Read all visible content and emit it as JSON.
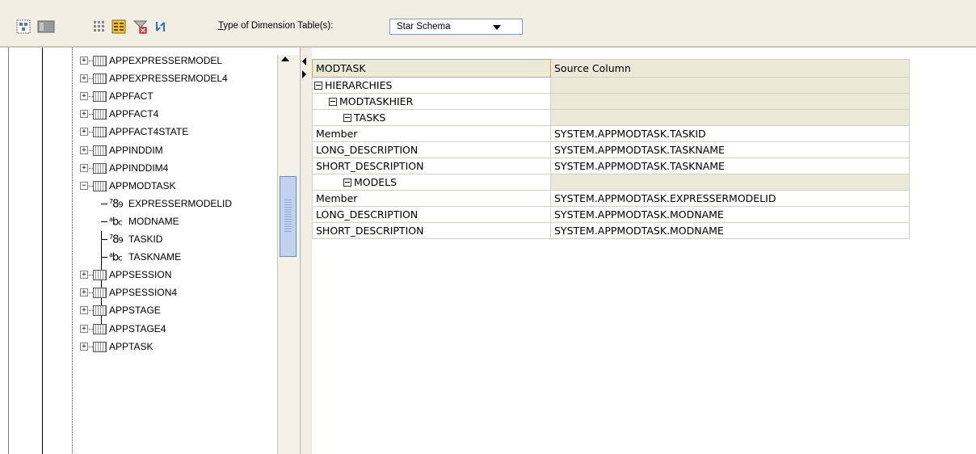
{
  "toolbar": {
    "icons": [
      "layout-icon",
      "panel-icon",
      "grid-icon",
      "table-columns-icon",
      "filter-delete-icon",
      "refresh-icon"
    ],
    "dim_label_accel": "T",
    "dim_label_rest": "ype of Dimension Table(s):",
    "dim_select_value": "Star Schema"
  },
  "tree": {
    "items": [
      {
        "label": "APPEXPRESSERMODEL",
        "kind": "table",
        "expander": "+"
      },
      {
        "label": "APPEXPRESSERMODEL4",
        "kind": "table",
        "expander": "+"
      },
      {
        "label": "APPFACT",
        "kind": "table",
        "expander": "+"
      },
      {
        "label": "APPFACT4",
        "kind": "table",
        "expander": "+"
      },
      {
        "label": "APPFACT4STATE",
        "kind": "table",
        "expander": "+"
      },
      {
        "label": "APPINDDIM",
        "kind": "table",
        "expander": "+"
      },
      {
        "label": "APPINDDIM4",
        "kind": "table",
        "expander": "+"
      },
      {
        "label": "APPMODTASK",
        "kind": "table",
        "expander": "−"
      },
      {
        "label": "EXPRESSERMODELID",
        "kind": "number"
      },
      {
        "label": "MODNAME",
        "kind": "text"
      },
      {
        "label": "TASKID",
        "kind": "number"
      },
      {
        "label": "TASKNAME",
        "kind": "text"
      },
      {
        "label": "APPSESSION",
        "kind": "table",
        "expander": "+"
      },
      {
        "label": "APPSESSION4",
        "kind": "table",
        "expander": "+"
      },
      {
        "label": "APPSTAGE",
        "kind": "table",
        "expander": "+"
      },
      {
        "label": "APPSTAGE4",
        "kind": "table",
        "expander": "+"
      },
      {
        "label": "APPTASK",
        "kind": "table",
        "expander": "+"
      }
    ]
  },
  "grid": {
    "headers": {
      "col1": "MODTASK",
      "col2": "Source Column"
    },
    "rows": [
      {
        "level": 0,
        "label": "HIERARCHIES",
        "collapsible": true,
        "source": ""
      },
      {
        "level": 1,
        "label": "MODTASKHIER",
        "collapsible": true,
        "source": ""
      },
      {
        "level": 2,
        "label": "TASKS",
        "collapsible": true,
        "source": ""
      },
      {
        "level": 3,
        "label": "Member",
        "collapsible": false,
        "source": "SYSTEM.APPMODTASK.TASKID"
      },
      {
        "level": 3,
        "label": "LONG_DESCRIPTION",
        "collapsible": false,
        "source": "SYSTEM.APPMODTASK.TASKNAME"
      },
      {
        "level": 3,
        "label": "SHORT_DESCRIPTION",
        "collapsible": false,
        "source": "SYSTEM.APPMODTASK.TASKNAME"
      },
      {
        "level": 2,
        "label": "MODELS",
        "collapsible": true,
        "source": ""
      },
      {
        "level": 3,
        "label": "Member",
        "collapsible": false,
        "source": "SYSTEM.APPMODTASK.EXPRESSERMODELID"
      },
      {
        "level": 3,
        "label": "LONG_DESCRIPTION",
        "collapsible": false,
        "source": "SYSTEM.APPMODTASK.MODNAME"
      },
      {
        "level": 3,
        "label": "SHORT_DESCRIPTION",
        "collapsible": false,
        "source": "SYSTEM.APPMODTASK.MODNAME"
      }
    ]
  }
}
